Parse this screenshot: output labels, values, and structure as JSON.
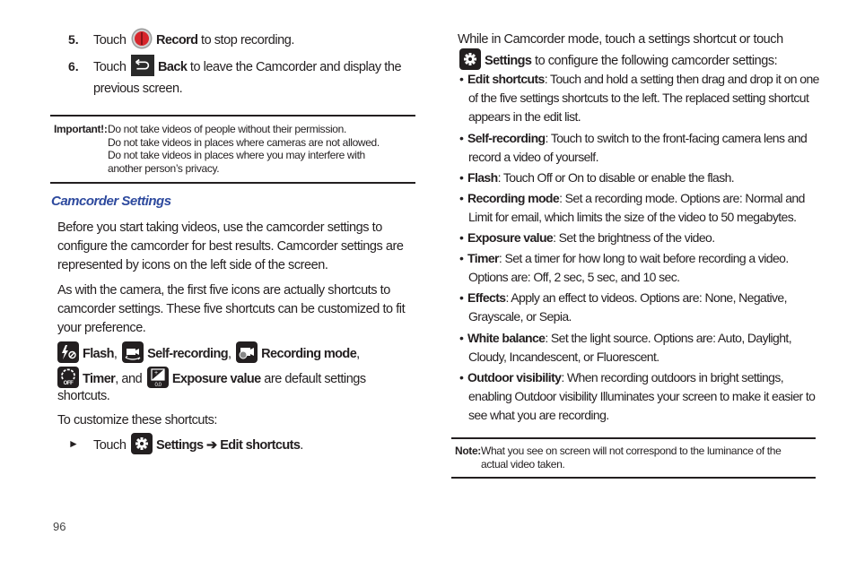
{
  "page_number": "96",
  "left": {
    "steps": [
      {
        "number": "5.",
        "pre": "Touch",
        "icon": "record-icon",
        "bold": "Record",
        "post": " to stop recording."
      },
      {
        "number": "6.",
        "pre": "Touch",
        "icon": "back-icon",
        "bold": "Back",
        "post": " to leave the Camcorder and display the",
        "post2": "previous screen."
      }
    ],
    "important": {
      "label": "Important!:",
      "lines": [
        "Do not take videos of people without their permission.",
        "Do not take videos in places where cameras are not allowed.",
        "Do not take videos in places where you may interfere with",
        "another person’s privacy."
      ]
    },
    "heading": "Camcorder Settings",
    "para1": [
      "Before you start taking videos, use the camcorder settings to",
      "configure the camcorder for best results. Camcorder settings are",
      "represented by icons on the left side of the screen."
    ],
    "para2": [
      "As with the camera, the first five icons are actually shortcuts to",
      "camcorder settings. These five shortcuts can be customized to fit",
      "your preference."
    ],
    "shortcuts": {
      "flash": "Flash",
      "self_recording": "Self-recording",
      "recording_mode": "Recording mode",
      "timer": "Timer",
      "and": ", and ",
      "exposure_value": "Exposure value",
      "suffix": " are default settings",
      "suffix2": "shortcuts.",
      "comma": ","
    },
    "customize_intro": "To customize these shortcuts:",
    "customize_step": {
      "marker": "►",
      "pre": "Touch",
      "settings": "Settings",
      "arrow": "➔",
      "edit": "Edit shortcuts",
      "end": "."
    }
  },
  "right": {
    "intro1": "While in Camcorder mode, touch a settings shortcut or touch",
    "intro2_bold": "Settings",
    "intro2": " to configure the following camcorder settings:",
    "bullets": [
      {
        "term": "Edit shortcuts",
        "lines": [
          ": Touch and hold a setting then drag and drop it on one",
          "of the five settings shortcuts to the left. The replaced setting shortcut",
          "appears in the edit list."
        ]
      },
      {
        "term": "Self-recording",
        "lines": [
          ": Touch to switch to the front-facing camera lens and",
          "record a video of yourself."
        ]
      },
      {
        "term": "Flash",
        "lines": [
          ": Touch Off or On to disable or enable the flash."
        ]
      },
      {
        "term": "Recording mode",
        "lines": [
          ": Set a recording mode. Options are: Normal and",
          "Limit for email, which limits the size of the video to 50 megabytes."
        ]
      },
      {
        "term": "Exposure value",
        "lines": [
          ": Set the brightness of the video."
        ]
      },
      {
        "term": "Timer",
        "lines": [
          ": Set a timer for how long to wait before recording a video.",
          "Options are: Off, 2 sec, 5 sec, and 10 sec."
        ]
      },
      {
        "term": "Effects",
        "lines": [
          ": Apply an effect to videos. Options are: None, Negative,",
          "Grayscale, or Sepia."
        ]
      },
      {
        "term": "White balance",
        "lines": [
          ": Set the light source. Options are: Auto, Daylight,",
          "Cloudy, Incandescent, or Fluorescent."
        ]
      },
      {
        "term": "Outdoor visibility",
        "lines": [
          ": When recording outdoors in bright settings,",
          "enabling Outdoor visibility Illuminates your screen to make it easier to",
          "see what you are recording."
        ]
      }
    ],
    "note": {
      "label": "Note:",
      "lines": [
        "What you see on screen will not correspond to the luminance of the",
        "actual video taken."
      ]
    }
  },
  "colors": {
    "heading": "#2e4a9e",
    "text": "#231f20",
    "record_red": "#d7262c"
  }
}
